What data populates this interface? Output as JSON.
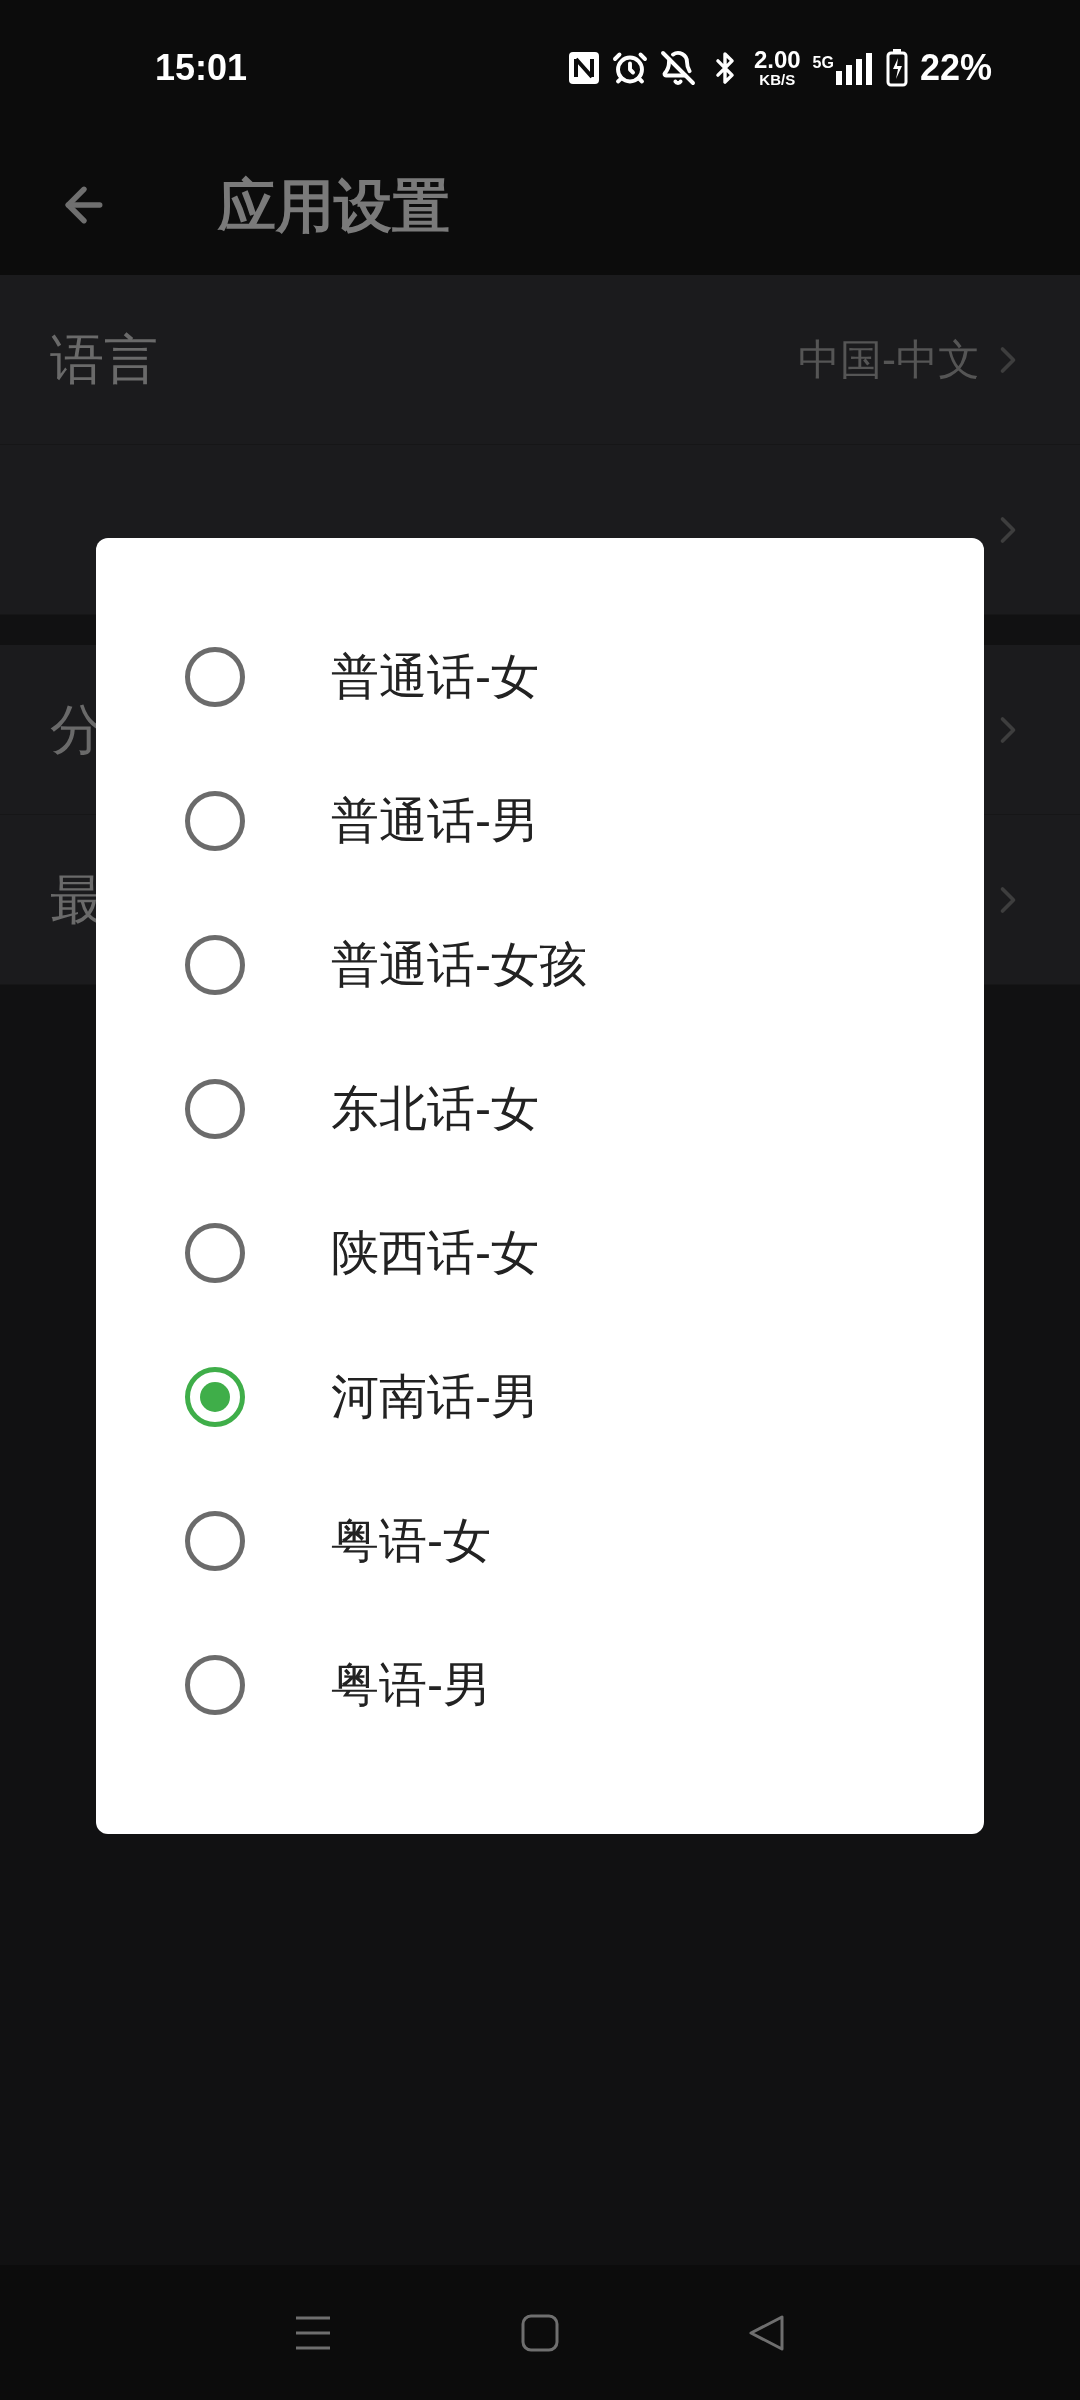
{
  "status_bar": {
    "time": "15:01",
    "speed": "2.00",
    "speed_unit": "KB/S",
    "network": "5G",
    "battery": "22%"
  },
  "app_bar": {
    "title": "应用设置"
  },
  "settings_groups": [
    [
      {
        "label": "语言",
        "value": "中国-中文",
        "chevron": true
      },
      {
        "chevron": true
      }
    ],
    [
      {
        "label": "分",
        "chevron": true
      },
      {
        "label": "最",
        "chevron": true
      }
    ]
  ],
  "dialog": {
    "options": [
      {
        "label": "普通话-女",
        "selected": false
      },
      {
        "label": "普通话-男",
        "selected": false
      },
      {
        "label": "普通话-女孩",
        "selected": false
      },
      {
        "label": "东北话-女",
        "selected": false
      },
      {
        "label": "陕西话-女",
        "selected": false
      },
      {
        "label": "河南话-男",
        "selected": true
      },
      {
        "label": "粤语-女",
        "selected": false
      },
      {
        "label": "粤语-男",
        "selected": false
      }
    ]
  }
}
